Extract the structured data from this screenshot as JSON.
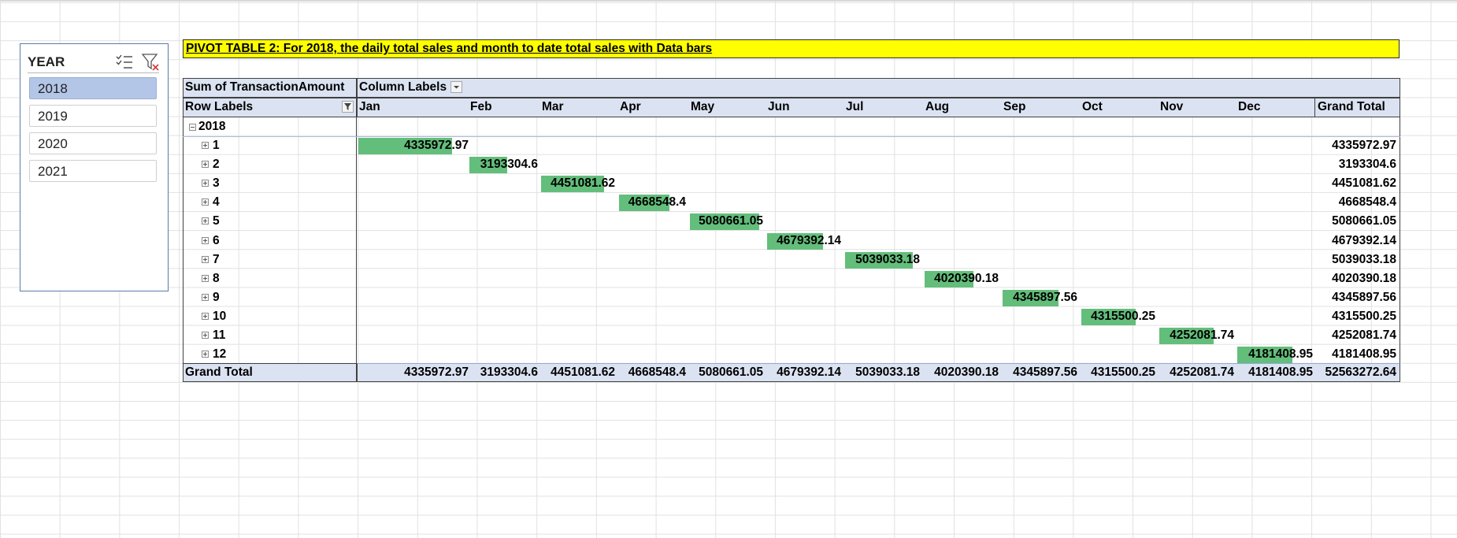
{
  "slicer": {
    "title": "YEAR",
    "items": [
      {
        "label": "2018",
        "selected": true
      },
      {
        "label": "2019",
        "selected": false
      },
      {
        "label": "2020",
        "selected": false
      },
      {
        "label": "2021",
        "selected": false
      }
    ],
    "icons": [
      "multi-select-icon",
      "clear-filter-icon"
    ]
  },
  "banner": {
    "text": "PIVOT TABLE 2: For 2018, the daily total sales and month to date total sales with Data bars",
    "color": "#ffff00"
  },
  "pivot": {
    "values_header": "Sum of TransactionAmount",
    "column_labels": "Column Labels",
    "row_labels": "Row Labels",
    "months": [
      "Jan",
      "Feb",
      "Mar",
      "Apr",
      "May",
      "Jun",
      "Jul",
      "Aug",
      "Sep",
      "Oct",
      "Nov",
      "Dec"
    ],
    "grand_total_header": "Grand Total",
    "year": "2018",
    "rows": [
      {
        "label": "1",
        "value": "4335972.97",
        "total": "4335972.97"
      },
      {
        "label": "2",
        "value": "3193304.6",
        "total": "3193304.6"
      },
      {
        "label": "3",
        "value": "4451081.62",
        "total": "4451081.62"
      },
      {
        "label": "4",
        "value": "4668548.4",
        "total": "4668548.4"
      },
      {
        "label": "5",
        "value": "5080661.05",
        "total": "5080661.05"
      },
      {
        "label": "6",
        "value": "4679392.14",
        "total": "4679392.14"
      },
      {
        "label": "7",
        "value": "5039033.18",
        "total": "5039033.18"
      },
      {
        "label": "8",
        "value": "4020390.18",
        "total": "4020390.18"
      },
      {
        "label": "9",
        "value": "4345897.56",
        "total": "4345897.56"
      },
      {
        "label": "10",
        "value": "4315500.25",
        "total": "4315500.25"
      },
      {
        "label": "11",
        "value": "4252081.74",
        "total": "4252081.74"
      },
      {
        "label": "12",
        "value": "4181408.95",
        "total": "4181408.95"
      }
    ],
    "grand_total_label": "Grand Total",
    "column_totals": [
      "4335972.97",
      "3193304.6",
      "4451081.62",
      "4668548.4",
      "5080661.05",
      "4679392.14",
      "5039033.18",
      "4020390.18",
      "4345897.56",
      "4315500.25",
      "4252081.74",
      "4181408.95"
    ],
    "overall_total": "52563272.64",
    "databar_color": "#63be7b",
    "header_color": "#dbe3f2"
  }
}
